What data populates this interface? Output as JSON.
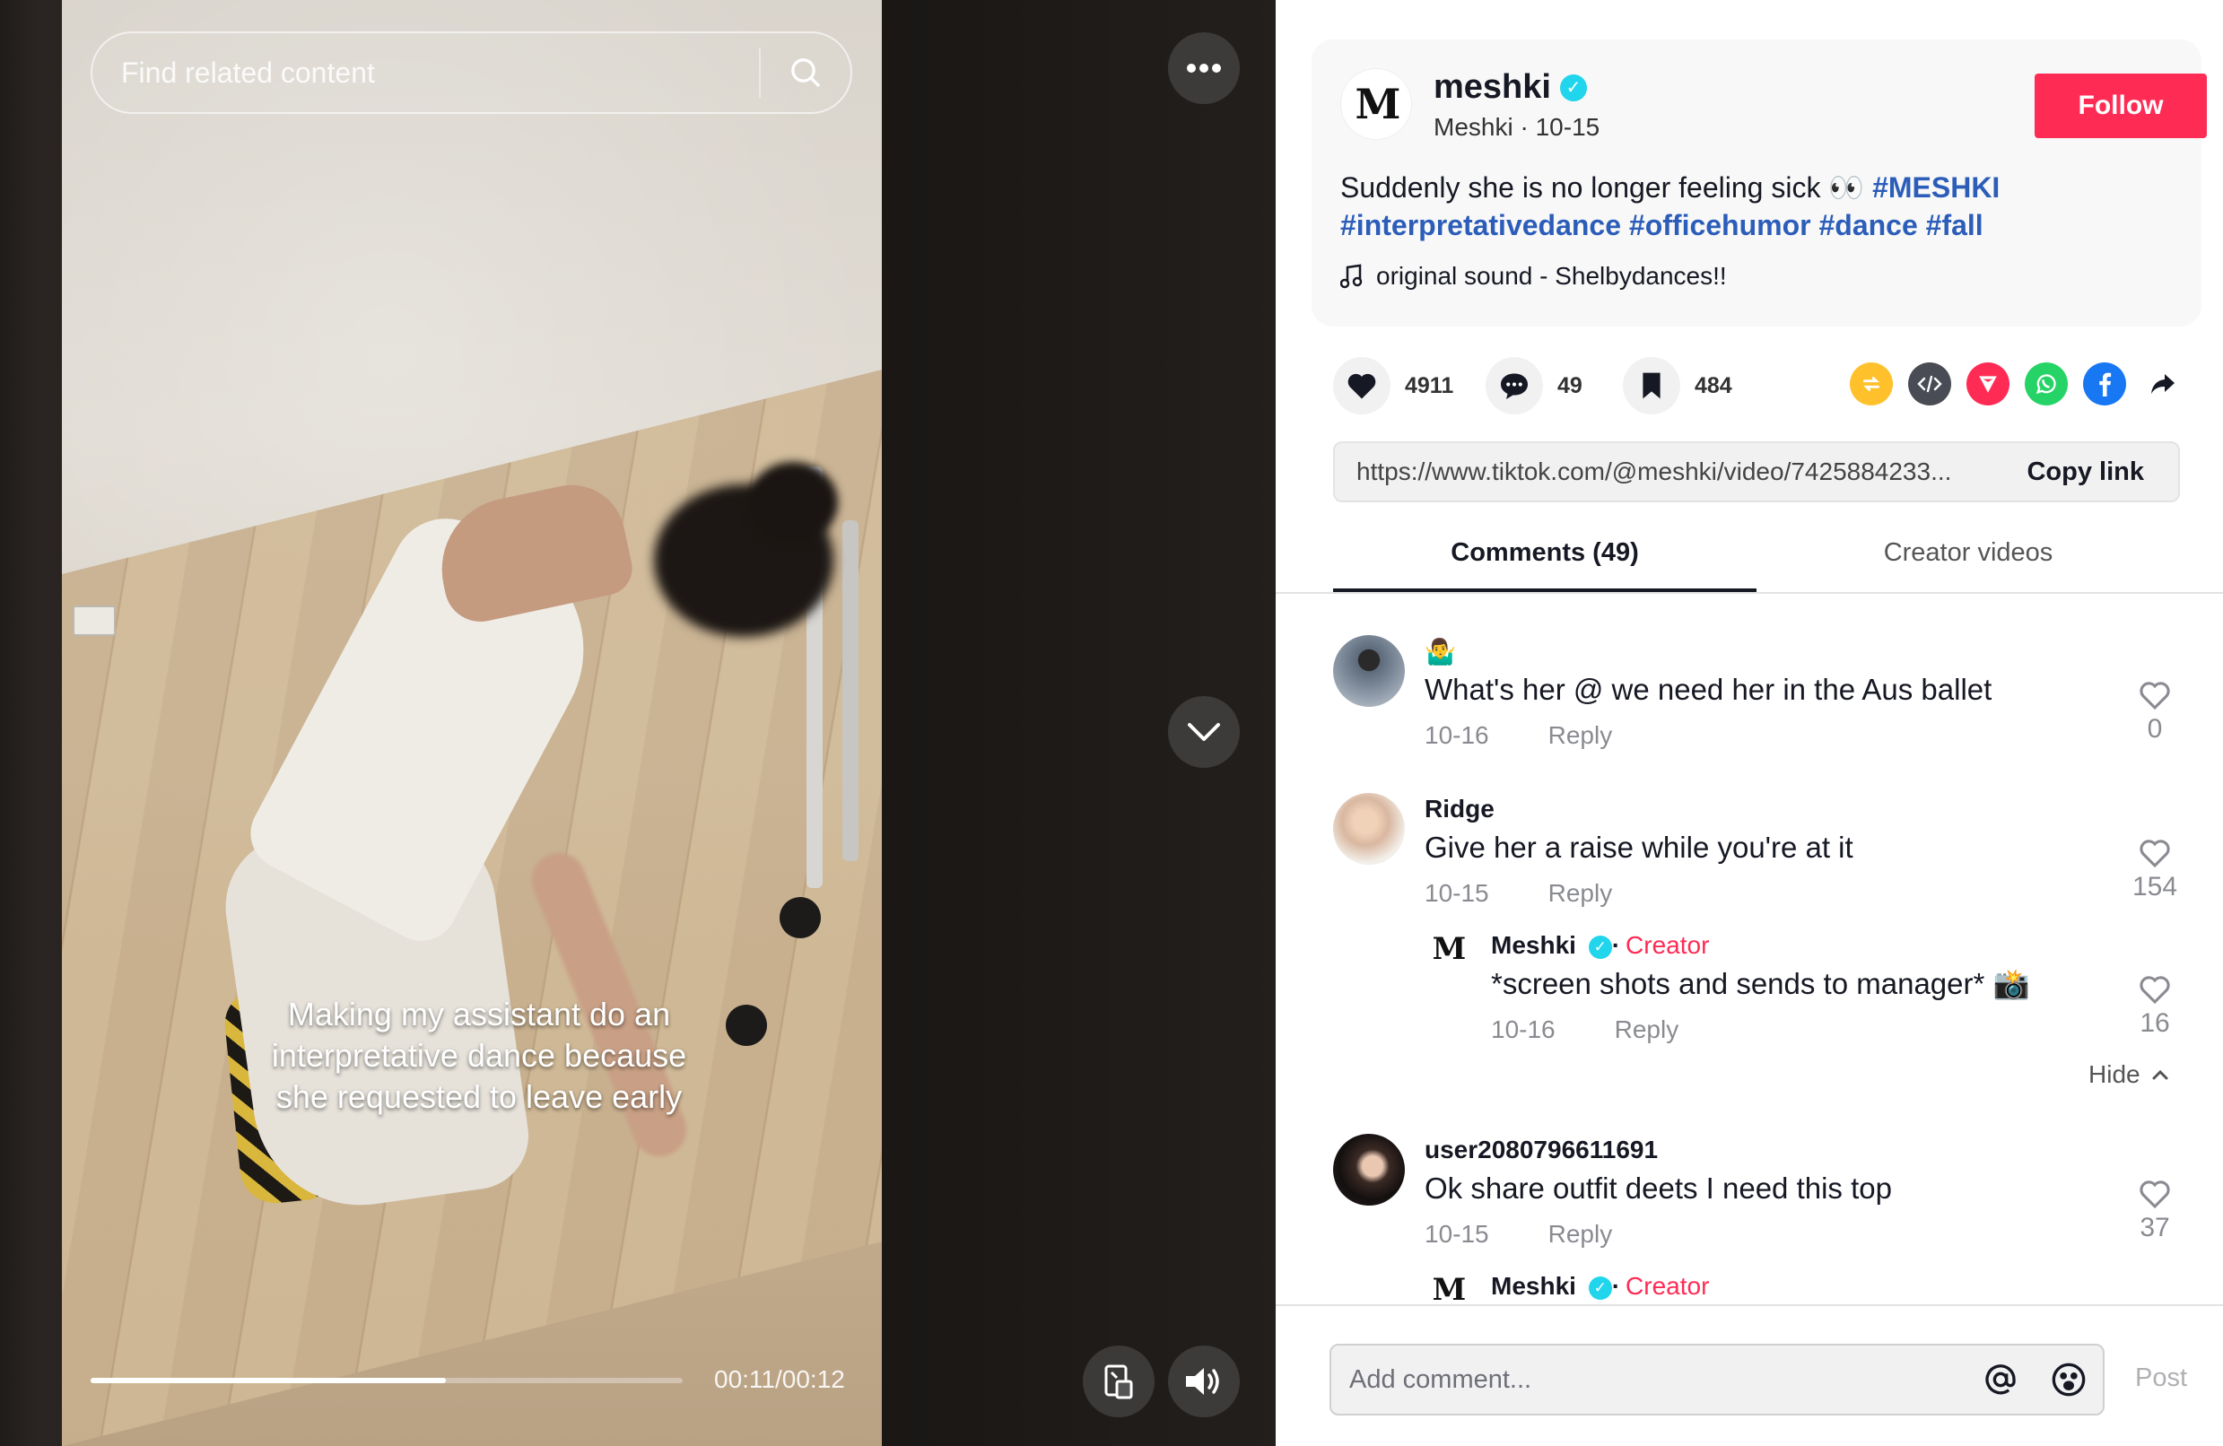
{
  "video": {
    "search_placeholder": "Find related content",
    "caption": "Making my assistant do an interpretative dance because she requested to leave early",
    "time_readout": "00:11/00:12",
    "progress": 0.6
  },
  "author": {
    "username": "meshki",
    "display_name": "Meshki",
    "date": "10-15",
    "follow_label": "Follow",
    "description_text": "Suddenly she is no longer feeling sick 👀 ",
    "hashtags": [
      "#MESHKI",
      "#interpretativedance",
      "#officehumor",
      "#dance",
      "#fall"
    ],
    "sound": "original sound - Shelbydances!!"
  },
  "stats": {
    "likes": "4911",
    "comments": "49",
    "saves": "484"
  },
  "link": {
    "url": "https://www.tiktok.com/@meshki/video/7425884233...",
    "copy_label": "Copy link"
  },
  "tabs": {
    "comments": "Comments (49)",
    "creator_videos": "Creator videos"
  },
  "comments": [
    {
      "name": "🤷‍♂️",
      "text": "What's her @ we need her in the Aus ballet",
      "date": "10-16",
      "reply": "Reply",
      "likes": "0"
    },
    {
      "name": "Ridge",
      "text": "Give her a raise while you're at it",
      "date": "10-15",
      "reply": "Reply",
      "likes": "154"
    },
    {
      "name": "Meshki",
      "creator": "Creator",
      "text": "*screen shots and sends to manager* 📸",
      "date": "10-16",
      "reply": "Reply",
      "likes": "16"
    },
    {
      "name": "user2080796611691",
      "text": "Ok share outfit deets I need this top",
      "date": "10-15",
      "reply": "Reply",
      "likes": "37"
    },
    {
      "name": "Meshki",
      "creator": "Creator"
    }
  ],
  "hide_label": "Hide",
  "composer": {
    "placeholder": "Add comment...",
    "post_label": "Post"
  },
  "colors": {
    "follow": "#fe2c55",
    "hashtag": "#2b5db9",
    "creator": "#fe2c55",
    "verified": "#20d5ec"
  }
}
